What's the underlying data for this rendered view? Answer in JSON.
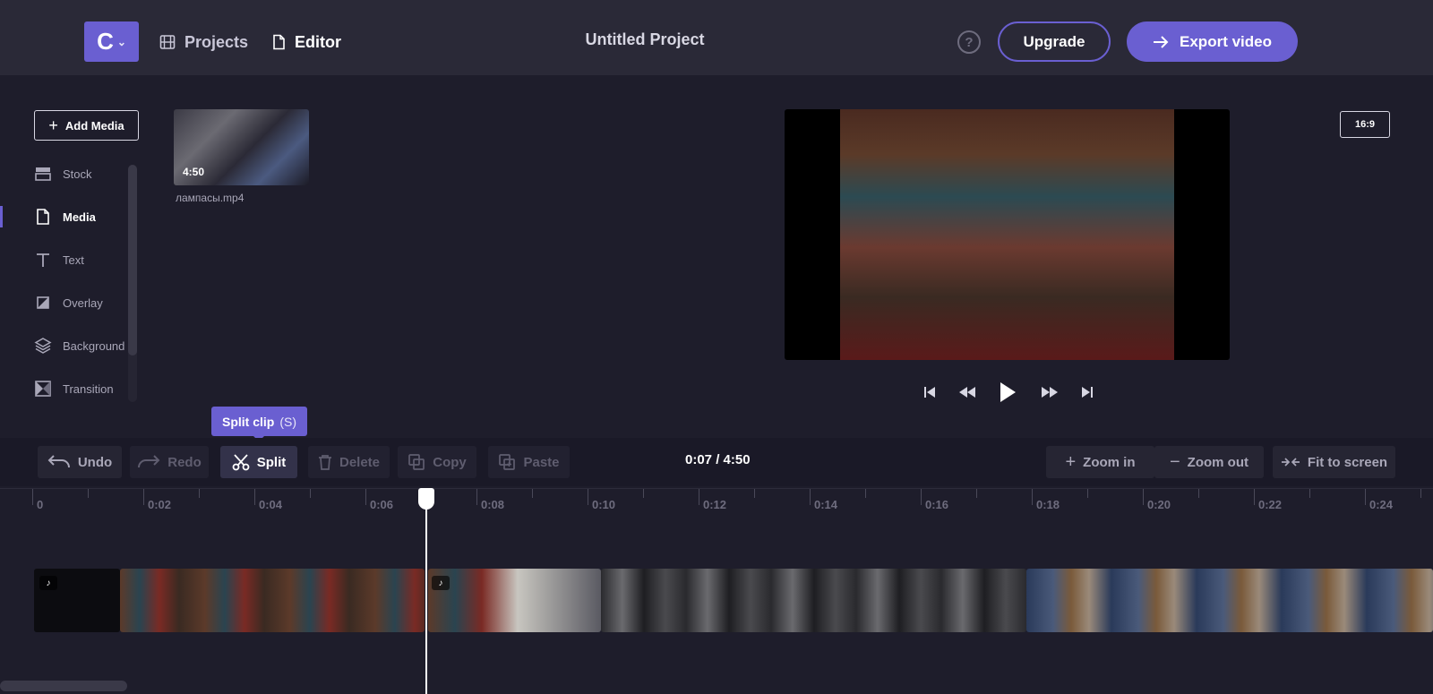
{
  "header": {
    "logo": "C",
    "nav": [
      {
        "label": "Projects",
        "icon": "film-icon"
      },
      {
        "label": "Editor",
        "icon": "document-icon"
      }
    ],
    "project_title": "Untitled Project",
    "help": "?",
    "upgrade_label": "Upgrade",
    "export_label": "Export video"
  },
  "sidebar": {
    "add_media_label": "Add Media",
    "items": [
      {
        "label": "Stock",
        "icon": "stock-icon"
      },
      {
        "label": "Media",
        "icon": "file-icon"
      },
      {
        "label": "Text",
        "icon": "text-icon"
      },
      {
        "label": "Overlay",
        "icon": "overlay-icon"
      },
      {
        "label": "Background",
        "icon": "layers-icon"
      },
      {
        "label": "Transition",
        "icon": "transition-icon"
      }
    ]
  },
  "media": {
    "duration": "4:50",
    "filename": "лампасы.mp4"
  },
  "preview": {
    "ratio": "16:9"
  },
  "tooltip": {
    "label": "Split clip",
    "shortcut": "(S)"
  },
  "toolbar": {
    "undo": "Undo",
    "redo": "Redo",
    "split": "Split",
    "delete": "Delete",
    "copy": "Copy",
    "paste": "Paste",
    "timecode": "0:07 / 4:50",
    "zoom_in": "Zoom in",
    "zoom_out": "Zoom out",
    "fit": "Fit to screen"
  },
  "ruler": {
    "labels": [
      "0",
      "0:02",
      "0:04",
      "0:06",
      "0:08",
      "0:10",
      "0:12",
      "0:14",
      "0:16",
      "0:18",
      "0:20",
      "0:22",
      "0:24"
    ]
  },
  "colors": {
    "accent": "#6a5fd1",
    "background": "#1e1d2b",
    "topbar": "#2a2937"
  }
}
